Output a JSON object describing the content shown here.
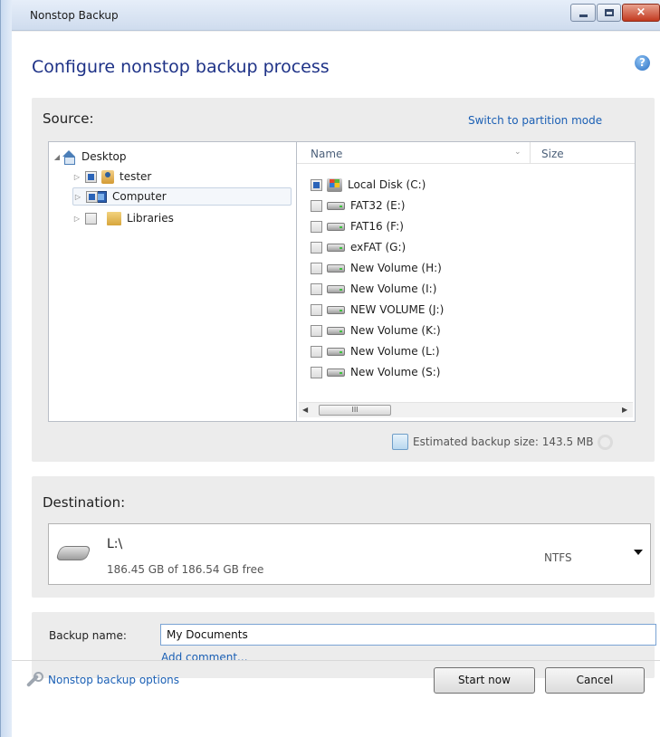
{
  "window": {
    "title": "Nonstop Backup",
    "close_glyph": "×"
  },
  "page": {
    "title": "Configure nonstop backup process",
    "help_glyph": "?"
  },
  "source": {
    "label": "Source:",
    "switch_link": "Switch to partition mode",
    "tree": [
      {
        "label": "Desktop",
        "arrow": "◢",
        "icon": "home-icon"
      },
      {
        "label": "tester",
        "arrow": "▷",
        "icon": "user-folder-icon",
        "checkbox": "partial"
      },
      {
        "label": "Computer",
        "arrow": "▷",
        "icon": "computer-icon",
        "checkbox": "partial",
        "selected": true
      },
      {
        "label": "Libraries",
        "arrow": "▷",
        "icon": "libraries-folder-icon",
        "checkbox": "unchecked"
      }
    ],
    "list_columns": {
      "name": "Name",
      "size": "Size",
      "sort_glyph": "⌄"
    },
    "drives": [
      {
        "label": "Local Disk (C:)",
        "state": "partial",
        "icon": "windows-drive-icon"
      },
      {
        "label": "FAT32 (E:)",
        "state": "unchecked",
        "icon": "drive-icon"
      },
      {
        "label": "FAT16 (F:)",
        "state": "unchecked",
        "icon": "drive-icon"
      },
      {
        "label": "exFAT (G:)",
        "state": "unchecked",
        "icon": "drive-icon"
      },
      {
        "label": "New Volume (H:)",
        "state": "unchecked",
        "icon": "drive-icon"
      },
      {
        "label": "New Volume (I:)",
        "state": "unchecked",
        "icon": "drive-icon"
      },
      {
        "label": "NEW VOLUME (J:)",
        "state": "unchecked",
        "icon": "drive-icon"
      },
      {
        "label": "New Volume (K:)",
        "state": "unchecked",
        "icon": "drive-icon"
      },
      {
        "label": "New Volume (L:)",
        "state": "unchecked",
        "icon": "drive-icon"
      },
      {
        "label": "New Volume (S:)",
        "state": "unchecked",
        "icon": "drive-icon"
      }
    ],
    "scrollbar": {
      "left": "◀",
      "thumb": "III",
      "right": "▶"
    },
    "estimate": "Estimated backup size: 143.5 MB"
  },
  "destination": {
    "label": "Destination:",
    "path": "L:\\",
    "free": "186.45 GB of 186.54 GB free",
    "filesystem": "NTFS"
  },
  "backup_name": {
    "label": "Backup name:",
    "value": "My Documents",
    "add_comment": "Add comment..."
  },
  "footer": {
    "options_link": "Nonstop backup options",
    "start_button": "Start now",
    "cancel_button": "Cancel"
  },
  "colors": {
    "title_blue": "#1e3287",
    "link_blue": "#1a5fb4",
    "checkbox_fill": "#2b64b8"
  }
}
